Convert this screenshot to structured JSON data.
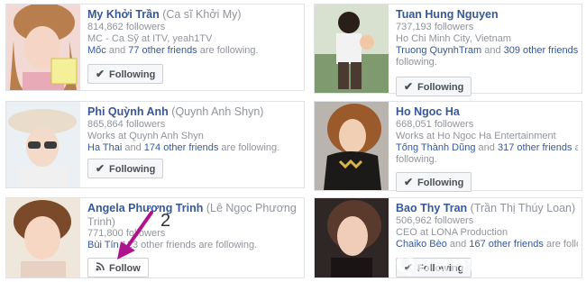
{
  "cards": [
    {
      "name": "My Khởi Trần",
      "alt_name": "(Ca sĩ Khởi My)",
      "followers": "814,862 followers",
      "detail": "MC - Ca Sỹ at ITV, yeah1TV",
      "friend_a": "Mốc",
      "friend_mid": " and ",
      "friend_b": "77 other friends",
      "friend_tail": " are following.",
      "button_label": "Following",
      "button_icon": "checkmark-icon"
    },
    {
      "name": "Tuan Hung Nguyen",
      "alt_name": "",
      "followers": "737,193 followers",
      "detail": "Ho Chi Minh City, Vietnam",
      "friend_a": "Truong QuynhTram",
      "friend_mid": " and ",
      "friend_b": "309 other friends",
      "friend_tail": " are",
      "extra_line": "following.",
      "button_label": "Following",
      "button_icon": "checkmark-icon"
    },
    {
      "name": "Phi Quỳnh Anh",
      "alt_name": "(Quynh Anh Shyn)",
      "followers": "865,864 followers",
      "detail": "Works at Quynh Anh Shyn",
      "friend_a": "Ha Thai",
      "friend_mid": " and ",
      "friend_b": "174 other friends",
      "friend_tail": " are following.",
      "button_label": "Following",
      "button_icon": "checkmark-icon"
    },
    {
      "name": "Ho Ngoc Ha",
      "alt_name": "",
      "followers": "668,051 followers",
      "detail": "Works at Ho Ngoc Ha Entertainment",
      "friend_a": "Tống Thành Dũng",
      "friend_mid": " and ",
      "friend_b": "317 other friends",
      "friend_tail": " are",
      "extra_line": "following.",
      "button_label": "Following",
      "button_icon": "checkmark-icon"
    },
    {
      "name": "Angela Phương Trinh",
      "alt_name": "(Lê Ngọc Phương",
      "alt_name_2": "Trinh)",
      "followers": "771,80",
      "followers_suffix": "0 followers",
      "friend_a": "Bùi Tín",
      "friend_mid": "",
      "friend_b": "123 other friends",
      "friend_tail": " are following.",
      "button_label": "Follow",
      "button_icon": "rss-icon"
    },
    {
      "name": "Bao Thy Tran",
      "alt_name": "(Trần Thị Thúy Loan)",
      "followers": "506,962 followers",
      "detail": "CEO at LONA Production",
      "friend_a": "Chaiko Bèo",
      "friend_mid": " and ",
      "friend_b": "167 other friends",
      "friend_tail": " are following.",
      "button_label": "Following",
      "button_icon": "checkmark-icon"
    }
  ],
  "annotation": {
    "number": "2",
    "arrow_color": "#b0128f"
  },
  "watermark": "Quantrimang"
}
